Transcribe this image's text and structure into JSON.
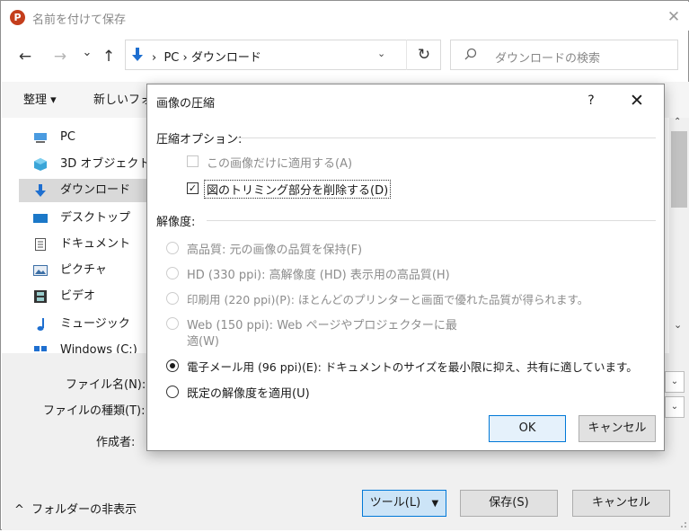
{
  "window": {
    "app_icon_letter": "P",
    "title": "名前を付けて保存",
    "close_glyph": "✕"
  },
  "nav": {
    "back_glyph": "←",
    "forward_glyph": "→",
    "recent_glyph": "⌄",
    "up_glyph": "↑"
  },
  "address": {
    "path": "PC  ›  ダウンロード",
    "leading_sep": "›",
    "dropdown_glyph": "⌄",
    "refresh_glyph": "↻"
  },
  "search": {
    "placeholder": "ダウンロードの検索",
    "icon_glyph": "⌕"
  },
  "toolbar": {
    "organize": "整理 ▾",
    "new_folder": "新しいフォ"
  },
  "sidebar": {
    "items": [
      {
        "label": "PC",
        "icon": "pc-icon"
      },
      {
        "label": "3D オブジェクト",
        "icon": "cube-icon"
      },
      {
        "label": "ダウンロード",
        "icon": "download-icon",
        "selected": true
      },
      {
        "label": "デスクトップ",
        "icon": "desktop-icon"
      },
      {
        "label": "ドキュメント",
        "icon": "document-icon"
      },
      {
        "label": "ピクチャ",
        "icon": "picture-icon"
      },
      {
        "label": "ビデオ",
        "icon": "video-icon"
      },
      {
        "label": "ミュージック",
        "icon": "music-icon"
      },
      {
        "label": "Windows (C:)",
        "icon": "drive-icon"
      }
    ]
  },
  "fields": {
    "filename_label": "ファイル名(N):",
    "filetype_label": "ファイルの種類(T):",
    "author_label": "作成者:"
  },
  "footer": {
    "hide_folders": "フォルダーの非表示",
    "hide_folders_glyph": "^",
    "tools": "ツール(L)",
    "tools_glyph": "▼",
    "save": "保存(S)",
    "cancel": "キャンセル"
  },
  "dialog": {
    "title": "画像の圧縮",
    "help": "?",
    "close": "✕",
    "compression_group": "圧縮オプション:",
    "apply_this_only": "この画像だけに適用する(A)",
    "delete_cropped": "図のトリミング部分を削除する(D)",
    "resolution_group": "解像度:",
    "options": [
      {
        "label": "高品質: 元の画像の品質を保持(F)",
        "enabled": false,
        "selected": false
      },
      {
        "label": "HD (330 ppi): 高解像度 (HD) 表示用の高品質(H)",
        "enabled": false,
        "selected": false
      },
      {
        "label": "印刷用 (220 ppi)(P): ほとんどのプリンターと画面で優れた品質が得られます。",
        "enabled": false,
        "selected": false
      },
      {
        "label": "Web (150 ppi): Web ページやプロジェクターに最",
        "label2": "適(W)",
        "enabled": false,
        "selected": false
      },
      {
        "label": "電子メール用 (96 ppi)(E): ドキュメントのサイズを最小限に抑え、共有に適しています。",
        "enabled": true,
        "selected": true
      },
      {
        "label": "既定の解像度を適用(U)",
        "enabled": true,
        "selected": false
      }
    ],
    "ok": "OK",
    "cancel": "キャンセル",
    "checkmark": "✓"
  },
  "colors": {
    "accent": "#0078d7",
    "app_icon": "#c43e1c"
  }
}
